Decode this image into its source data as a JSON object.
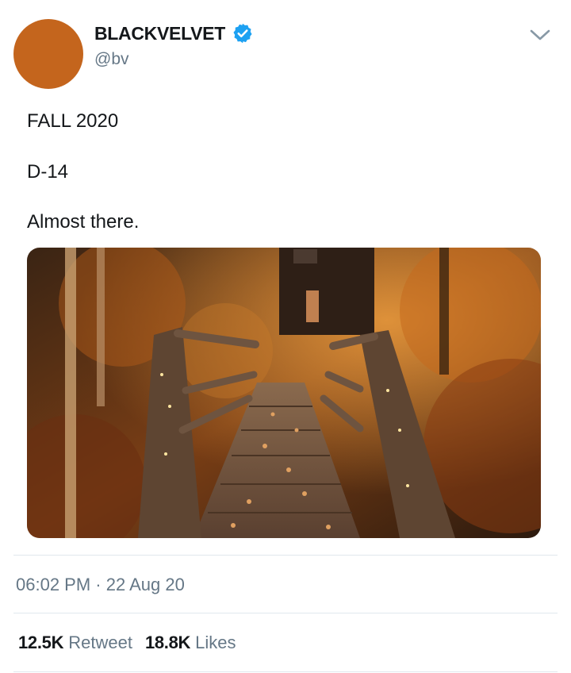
{
  "author": {
    "display_name": "BLACKVELVET",
    "handle": "@bv",
    "avatar_color": "#c4651d",
    "verified": true,
    "verified_color": "#1da1f2"
  },
  "tweet": {
    "lines": [
      "FALL 2020",
      "D-14",
      "Almost there."
    ],
    "media_icon": "photo-autumn-wooden-bridge"
  },
  "meta": {
    "timestamp": "06:02 PM · 22 Aug 20"
  },
  "stats": {
    "retweets": "12.5K",
    "retweets_label": "Retweet",
    "likes": "18.8K",
    "likes_label": "Likes"
  },
  "icons": [
    "verified-badge-icon",
    "chevron-down-icon"
  ]
}
